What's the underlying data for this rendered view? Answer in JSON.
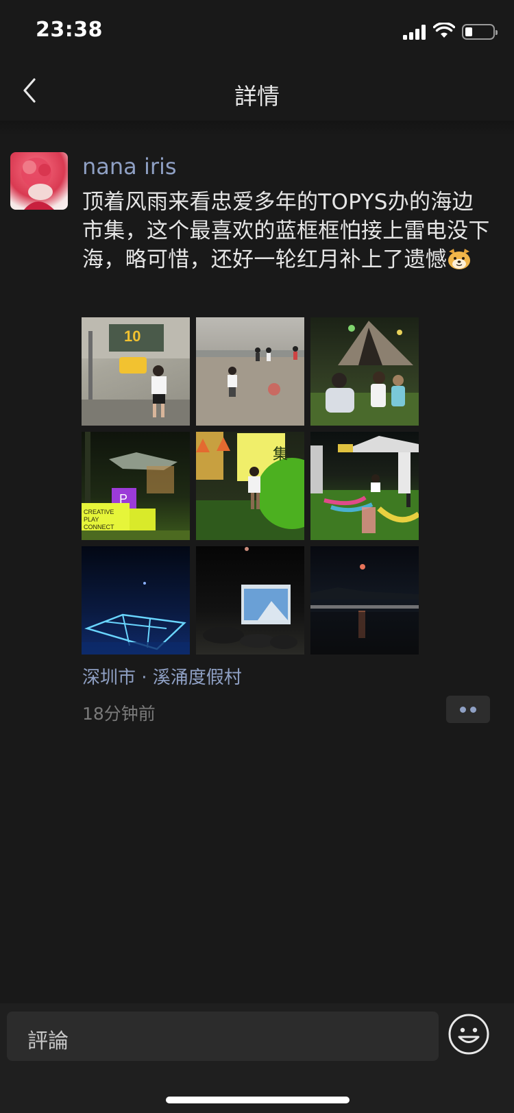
{
  "status_bar": {
    "time": "23:38",
    "icons": [
      "cellular-signal-icon",
      "wifi-icon",
      "battery-icon"
    ]
  },
  "nav": {
    "title": "詳情",
    "back_icon": "chevron-left-icon"
  },
  "post": {
    "author": "nana iris",
    "content": "顶着风雨来看忠爱多年的TOPYS办的海边市集，这个最喜欢的蓝框框怕接上雷电没下海，略可惜，还好一轮红月补上了遗憾",
    "content_emoji": "doge-emoji",
    "photos": [
      {
        "name": "photo-play-market-sign"
      },
      {
        "name": "photo-beach-ball"
      },
      {
        "name": "photo-tent-kids"
      },
      {
        "name": "photo-creative-play-connect"
      },
      {
        "name": "photo-green-ball"
      },
      {
        "name": "photo-lawn-playground"
      },
      {
        "name": "photo-blue-neon-square"
      },
      {
        "name": "photo-night-screen"
      },
      {
        "name": "photo-red-moon-sea"
      }
    ],
    "location": "深圳市 · 溪涌度假村",
    "time_ago": "18分钟前"
  },
  "comment_bar": {
    "placeholder": "評論",
    "emoji_icon": "smiley-face-icon"
  },
  "colors": {
    "background": "#191919",
    "link": "#8fa0c4",
    "text": "#e6e6e6",
    "muted": "#7a7a7a"
  }
}
